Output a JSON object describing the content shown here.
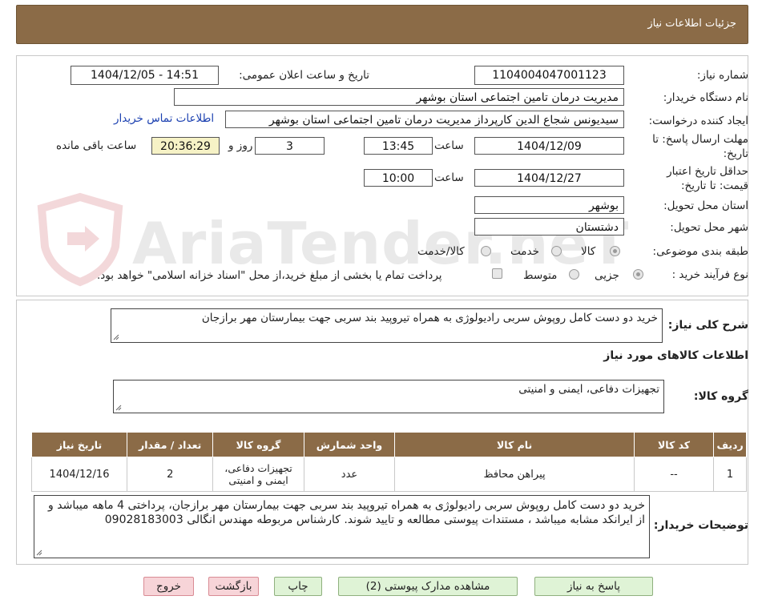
{
  "header": {
    "title": "جزئیات اطلاعات نیاز"
  },
  "watermark": "AriaTender.neT",
  "fields": {
    "need_number_label": "شماره نیاز:",
    "need_number": "1104004047001123",
    "announce_label": "تاریخ و ساعت اعلان عمومی:",
    "announce_value": "1404/12/05 - 14:51",
    "buyer_org_label": "نام دستگاه خریدار:",
    "buyer_org": "مدیریت درمان تامین اجتماعی استان بوشهر",
    "requester_label": "ایجاد کننده درخواست:",
    "requester": "سیدیونس شجاع الدین کارپرداز مدیریت درمان تامین اجتماعی استان بوشهر",
    "contact_link": "اطلاعات تماس خریدار",
    "deadline_label_1": "مهلت ارسال پاسخ: تا",
    "deadline_label_2": "تاریخ:",
    "deadline_date": "1404/12/09",
    "time_label": "ساعت",
    "deadline_time": "13:45",
    "days_count": "3",
    "days_label": "روز و",
    "remaining_time": "20:36:29",
    "remaining_label": "ساعت باقی مانده",
    "validity_label_1": "حداقل تاریخ اعتبار",
    "validity_label_2": "قیمت: تا تاریخ:",
    "validity_date": "1404/12/27",
    "validity_time": "10:00",
    "province_label": "استان محل تحویل:",
    "province": "بوشهر",
    "city_label": "شهر محل تحویل:",
    "city": "دشتستان",
    "category_label": "طبقه بندی موضوعی:",
    "category_options": [
      "کالا",
      "خدمت",
      "کالا/خدمت"
    ],
    "category_selected": "کالا",
    "process_label": "نوع فرآیند خرید :",
    "process_options": [
      "جزیی",
      "متوسط"
    ],
    "payment_note": "پرداخت تمام یا بخشی از مبلغ خرید،از محل \"اسناد خزانه اسلامی\" خواهد بود."
  },
  "description": {
    "label": "شرح کلی نیاز:",
    "text": "خرید دو دست کامل روپوش سربی رادیولوژی به همراه تیروپید بند سربی جهت بیمارستان مهر برازجان"
  },
  "goods": {
    "section_title": "اطلاعات کالاهای مورد نیاز",
    "group_label": "گروه کالا:",
    "group_value": "تجهیزات دفاعی، ایمنی و امنیتی",
    "columns": [
      "ردیف",
      "کد کالا",
      "نام کالا",
      "واحد شمارش",
      "گروه کالا",
      "تعداد / مقدار",
      "تاریخ نیاز"
    ],
    "rows": [
      {
        "row": "1",
        "code": "--",
        "name": "پیراهن محافظ",
        "unit": "عدد",
        "group": "تجهیزات دفاعی، ایمنی و امنیتی",
        "qty": "2",
        "date": "1404/12/16"
      }
    ]
  },
  "buyer_notes": {
    "label": "توضیحات خریدار:",
    "text": "خرید دو دست کامل روپوش سربی رادیولوژی به همراه تیروپید بند سربی جهت بیمارستان مهر برازجان، پرداختی 4 ماهه میباشد و از ایرانکد مشابه میباشد ، مستندات پیوستی  مطالعه و تایید شوند. کارشناس مربوطه مهندس انگالی 09028183003"
  },
  "buttons": {
    "reply": "پاسخ به نیاز",
    "attachments": "مشاهده مدارک پیوستی (2)",
    "print": "چاپ",
    "back": "بازگشت",
    "exit": "خروج"
  },
  "colors": {
    "header_brown": "#8b6b47",
    "button_green": "#dff3d6",
    "button_red": "#f7d4d8",
    "link_blue": "#1a3fb0"
  }
}
